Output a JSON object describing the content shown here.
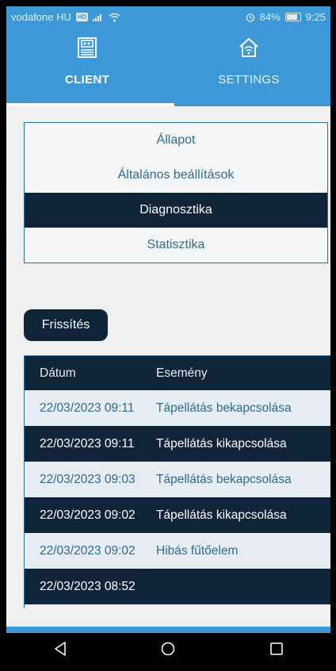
{
  "status_bar": {
    "carrier": "vodafone HU",
    "network_badge": "HD",
    "signal_icon": "signal-icon",
    "wifi_icon": "wifi-icon",
    "alarm_icon": "alarm-clock-icon",
    "battery_percent": "84%",
    "battery_level": 0.84,
    "time": "9:25"
  },
  "tabs": [
    {
      "label": "CLIENT",
      "icon": "client-panel-icon",
      "active": true
    },
    {
      "label": "SETTINGS",
      "icon": "home-wifi-icon",
      "active": false
    }
  ],
  "menu": {
    "items": [
      {
        "label": "Állapot",
        "active": false
      },
      {
        "label": "Általános beállítások",
        "active": false
      },
      {
        "label": "Diagnosztika",
        "active": true
      },
      {
        "label": "Statisztika",
        "active": false
      }
    ]
  },
  "refresh_label": "Frissítés",
  "events": {
    "headers": [
      "Dátum",
      "Esemény"
    ],
    "rows": [
      {
        "date": "22/03/2023 09:11",
        "event": "Tápellátás bekapcsolása"
      },
      {
        "date": "22/03/2023 09:11",
        "event": "Tápellátás kikapcsolása"
      },
      {
        "date": "22/03/2023 09:03",
        "event": "Tápellátás bekapcsolása"
      },
      {
        "date": "22/03/2023 09:02",
        "event": "Tápellátás kikapcsolása"
      },
      {
        "date": "22/03/2023 09:02",
        "event": "Hibás fűtőelem"
      },
      {
        "date": "22/03/2023 08:52",
        "event": ""
      }
    ]
  },
  "nav_buttons": [
    "back-icon",
    "home-icon",
    "recents-icon"
  ],
  "colors": {
    "primary": "#3d98d8",
    "dark": "#0f2438",
    "text_blue": "#2f6b95",
    "row_light": "#e6ecf1"
  }
}
